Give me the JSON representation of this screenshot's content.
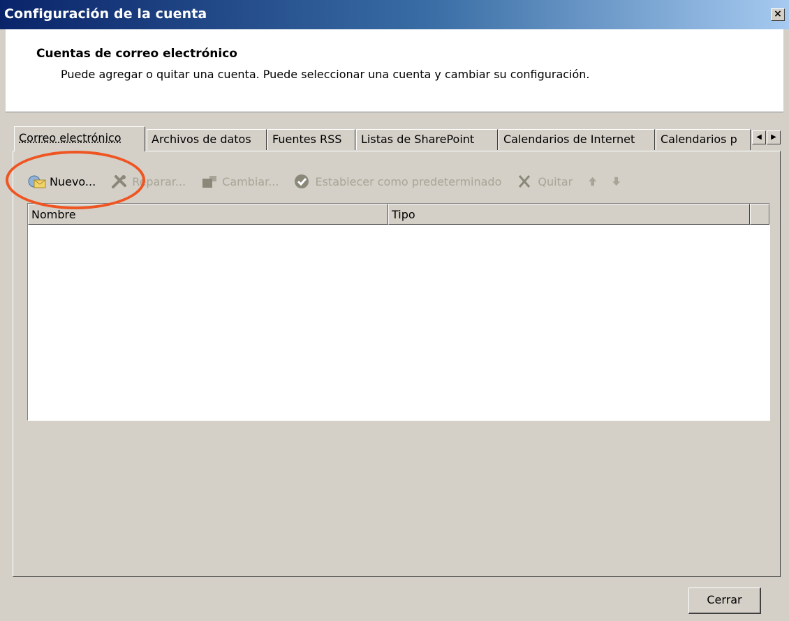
{
  "window": {
    "title": "Configuración de la cuenta",
    "close_label": "×"
  },
  "header": {
    "title": "Cuentas de correo electrónico",
    "description": "Puede agregar o quitar una cuenta. Puede seleccionar una cuenta y cambiar su configuración."
  },
  "tabs": [
    {
      "label": "Correo electrónico",
      "active": true
    },
    {
      "label": "Archivos de datos",
      "active": false
    },
    {
      "label": "Fuentes RSS",
      "active": false
    },
    {
      "label": "Listas de SharePoint",
      "active": false
    },
    {
      "label": "Calendarios de Internet",
      "active": false
    },
    {
      "label": "Calendarios p",
      "active": false
    }
  ],
  "tab_scroll": {
    "left": "◀",
    "right": "▶"
  },
  "toolbar": {
    "new_label": "Nuevo...",
    "repair_label": "Reparar...",
    "change_label": "Cambiar...",
    "set_default_label": "Establecer como predeterminado",
    "remove_label": "Quitar"
  },
  "list": {
    "columns": [
      "Nombre",
      "Tipo"
    ],
    "rows": []
  },
  "footer": {
    "close_label": "Cerrar"
  },
  "colors": {
    "annotation": "#ee5522",
    "title_gradient_start": "#0a246a",
    "dialog_bg": "#d4d0c8"
  }
}
